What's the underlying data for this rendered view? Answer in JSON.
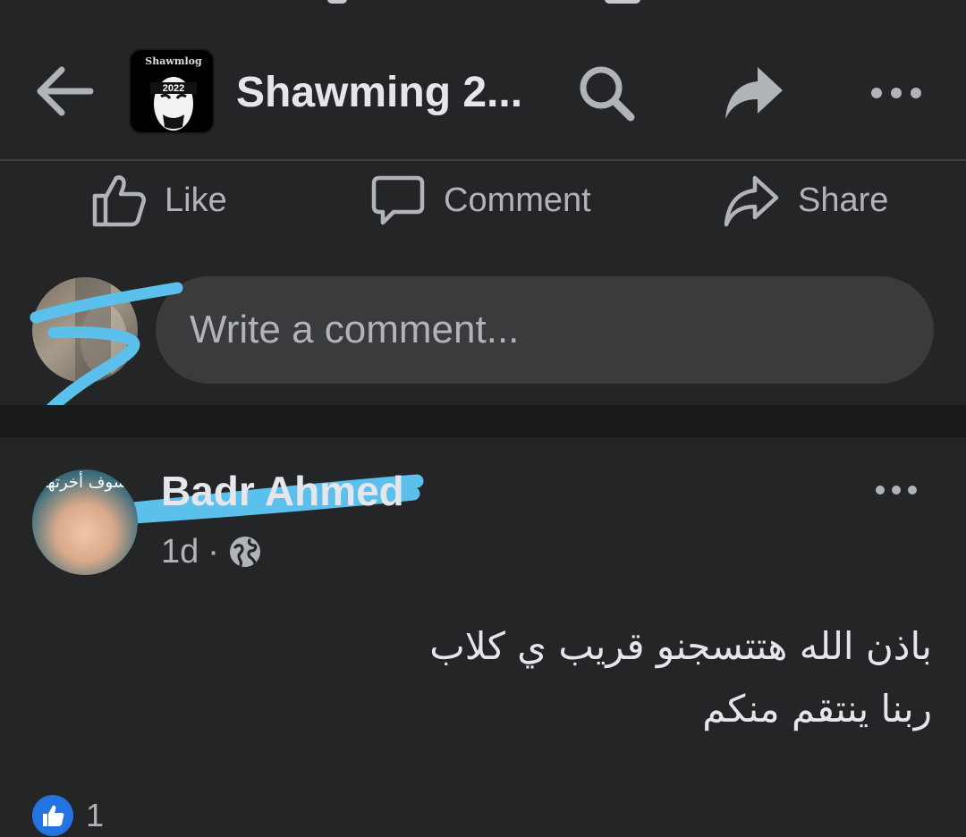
{
  "header": {
    "title": "Shawming 2...",
    "avatar_top_text": "Shawmlog",
    "avatar_badge_text": "2022"
  },
  "actions": {
    "like": "Like",
    "comment": "Comment",
    "share": "Share"
  },
  "composer": {
    "placeholder": "Write a comment..."
  },
  "comment": {
    "author": "Badr Ahmed",
    "avatar_caption": "سوف أخرتها",
    "time": "1d",
    "separator": "·",
    "body_lines": [
      "باذن الله هتتسجنو قريب ي كلاب",
      "ربنا ينتقم منكم"
    ],
    "reaction_count": "1"
  },
  "colors": {
    "background": "#242526",
    "input_bg": "#3a3b3c",
    "muted_text": "#b0b3b8",
    "like_blue": "#2374e1",
    "scribble_blue": "#5bc0eb"
  }
}
